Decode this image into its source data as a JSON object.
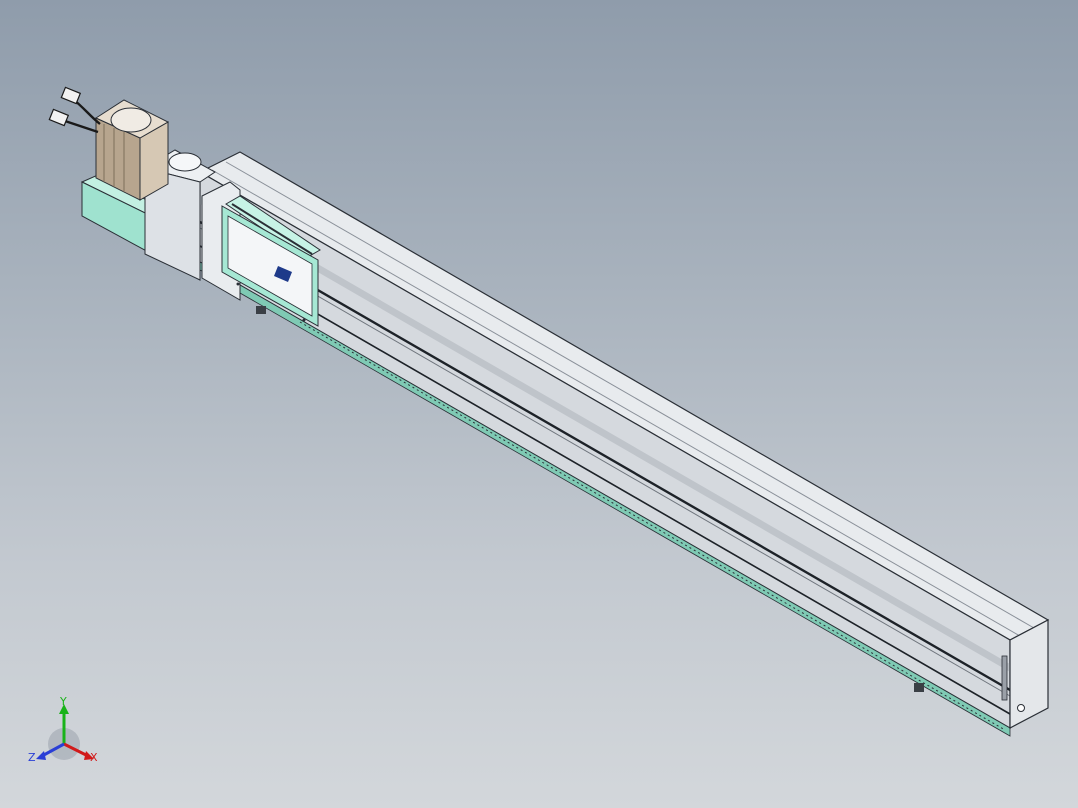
{
  "viewport": {
    "background_top": "#8f9cab",
    "background_bottom": "#d3d7db"
  },
  "model": {
    "carriage_logo_text": "",
    "colors": {
      "rail_body": "#d9dde2",
      "rail_edge": "#2a2f36",
      "motor_base": "#9fe2cf",
      "carriage_plate": "#a6e8d4",
      "logo_blue": "#1e3a8a"
    }
  },
  "triad": {
    "x_label": "X",
    "y_label": "Y",
    "z_label": "Z",
    "x_color": "#d11a1a",
    "y_color": "#19b319",
    "z_color": "#2a3fd6"
  }
}
